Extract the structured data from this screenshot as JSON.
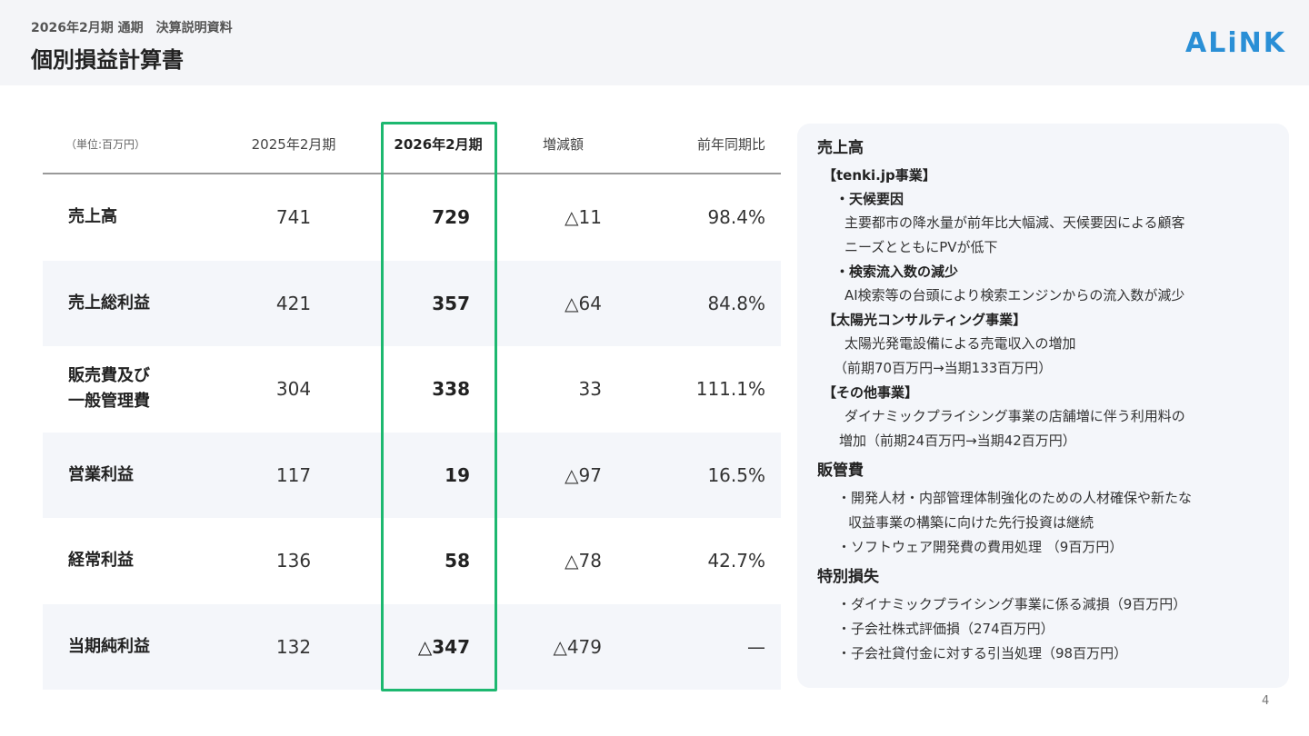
{
  "header": {
    "subtitle": "2026年2月期 通期　決算説明資料",
    "title": "個別損益計算書",
    "logo_text": "ALiNK"
  },
  "table": {
    "unit": "（単位:百万円）",
    "columns": [
      "2025年2月期",
      "2026年2月期",
      "増減額",
      "前年同期比"
    ],
    "rows": [
      {
        "label": "売上高",
        "prev": "741",
        "curr": "729",
        "diff": "△11",
        "ratio": "98.4%"
      },
      {
        "label": "売上総利益",
        "prev": "421",
        "curr": "357",
        "diff": "△64",
        "ratio": "84.8%"
      },
      {
        "label": "販売費及び\n一般管理費",
        "prev": "304",
        "curr": "338",
        "diff": "33",
        "ratio": "111.1%"
      },
      {
        "label": "営業利益",
        "prev": "117",
        "curr": "19",
        "diff": "△97",
        "ratio": "16.5%"
      },
      {
        "label": "経常利益",
        "prev": "136",
        "curr": "58",
        "diff": "△78",
        "ratio": "42.7%"
      },
      {
        "label": "当期純利益",
        "prev": "132",
        "curr": "△347",
        "diff": "△479",
        "ratio": "—"
      }
    ]
  },
  "panel": {
    "s1_title": "売上高",
    "s1_sub1": "【tenki.jp事業】",
    "s1_b1": "・天候要因",
    "s1_t1a": "主要都市の降水量が前年比大幅減、天候要因による顧客",
    "s1_t1b": "ニーズとともにPVが低下",
    "s1_b2": "・検索流入数の減少",
    "s1_t2": "AI検索等の台頭により検索エンジンからの流入数が減少",
    "s1_sub2": "【太陽光コンサルティング事業】",
    "s1_t3a": "太陽光発電設備による売電収入の増加",
    "s1_t3b": "（前期70百万円→当期133百万円）",
    "s1_sub3": "【その他事業】",
    "s1_t4a": "ダイナミックプライシング事業の店舗増に伴う利用料の",
    "s1_t4b": "増加（前期24百万円→当期42百万円）",
    "s2_title": "販管費",
    "s2_b1a": "・開発人材・内部管理体制強化のための人材確保や新たな",
    "s2_b1b": "収益事業の構築に向けた先行投資は継続",
    "s2_b2": "・ソフトウェア開発費の費用処理 （9百万円）",
    "s3_title": "特別損失",
    "s3_b1": "・ダイナミックプライシング事業に係る減損（9百万円）",
    "s3_b2": "・子会社株式評価損（274百万円）",
    "s3_b3": "・子会社貸付金に対する引当処理（98百万円）"
  },
  "page_number": "4",
  "colors": {
    "highlight": "#1db870",
    "logo": "#2a8fd6",
    "panel_bg": "#f4f6fa"
  }
}
